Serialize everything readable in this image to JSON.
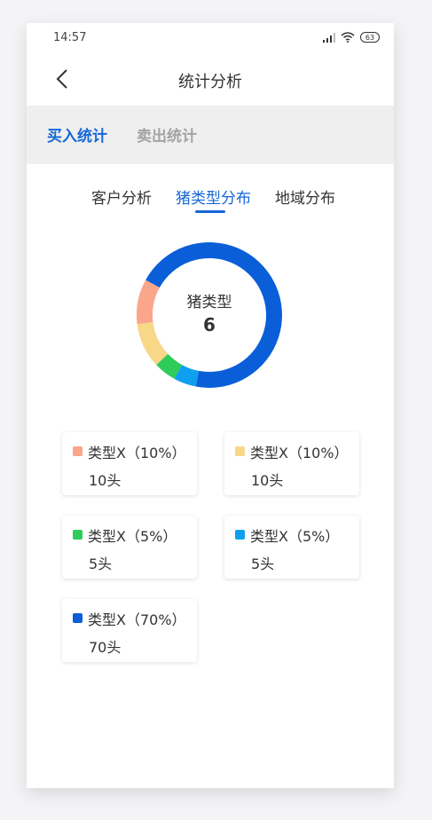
{
  "status_bar": {
    "time": "14:57",
    "battery": "63"
  },
  "nav": {
    "title": "统计分析"
  },
  "top_tabs": [
    {
      "label": "买入统计",
      "active": true
    },
    {
      "label": "卖出统计",
      "active": false
    }
  ],
  "sub_tabs": [
    {
      "label": "客户分析",
      "active": false
    },
    {
      "label": "猪类型分布",
      "active": true
    },
    {
      "label": "地域分布",
      "active": false
    }
  ],
  "summary": {
    "label": "猪类型",
    "value": "6"
  },
  "chart_data": {
    "type": "pie",
    "variant": "donut",
    "center_label": "猪类型",
    "center_value": 6,
    "slices": [
      {
        "label": "类型X（70%）",
        "value": 70,
        "percent": 70,
        "color": "#0a5fd8"
      },
      {
        "label": "类型X（5%）",
        "value": 5,
        "percent": 5,
        "color": "#0ea0ee"
      },
      {
        "label": "类型X（5%）",
        "value": 5,
        "percent": 5,
        "color": "#2ecc5a"
      },
      {
        "label": "类型X（10%）",
        "value": 10,
        "percent": 10,
        "color": "#f8d789"
      },
      {
        "label": "类型X（10%）",
        "value": 10,
        "percent": 10,
        "color": "#fba58d"
      }
    ]
  },
  "legend": [
    {
      "label": "类型X（10%）",
      "count": "10头",
      "color": "#fba58d"
    },
    {
      "label": "类型X（10%）",
      "count": "10头",
      "color": "#f8d789"
    },
    {
      "label": "类型X（5%）",
      "count": "5头",
      "color": "#2ecc5a"
    },
    {
      "label": "类型X（5%）",
      "count": "5头",
      "color": "#0ea0ee"
    },
    {
      "label": "类型X（70%）",
      "count": "70头",
      "color": "#0a5fd8"
    }
  ]
}
